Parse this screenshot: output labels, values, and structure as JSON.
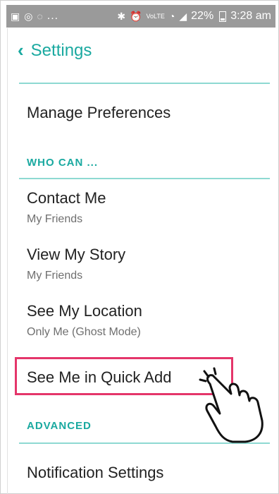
{
  "statusbar": {
    "left_dots": "...",
    "network": "VoLTE",
    "battery": "22%",
    "time": "3:28 am"
  },
  "header": {
    "title": "Settings"
  },
  "rows": {
    "manage_preferences": "Manage Preferences",
    "who_can_header": "WHO CAN ...",
    "contact_me": {
      "title": "Contact Me",
      "value": "My Friends"
    },
    "view_my_story": {
      "title": "View My Story",
      "value": "My Friends"
    },
    "see_my_location": {
      "title": "See My Location",
      "value": "Only Me (Ghost Mode)"
    },
    "quick_add": "See Me in Quick Add",
    "advanced_header": "ADVANCED",
    "notification_settings": "Notification Settings"
  },
  "colors": {
    "accent": "#1aa9a0",
    "highlight": "#e4356a"
  }
}
